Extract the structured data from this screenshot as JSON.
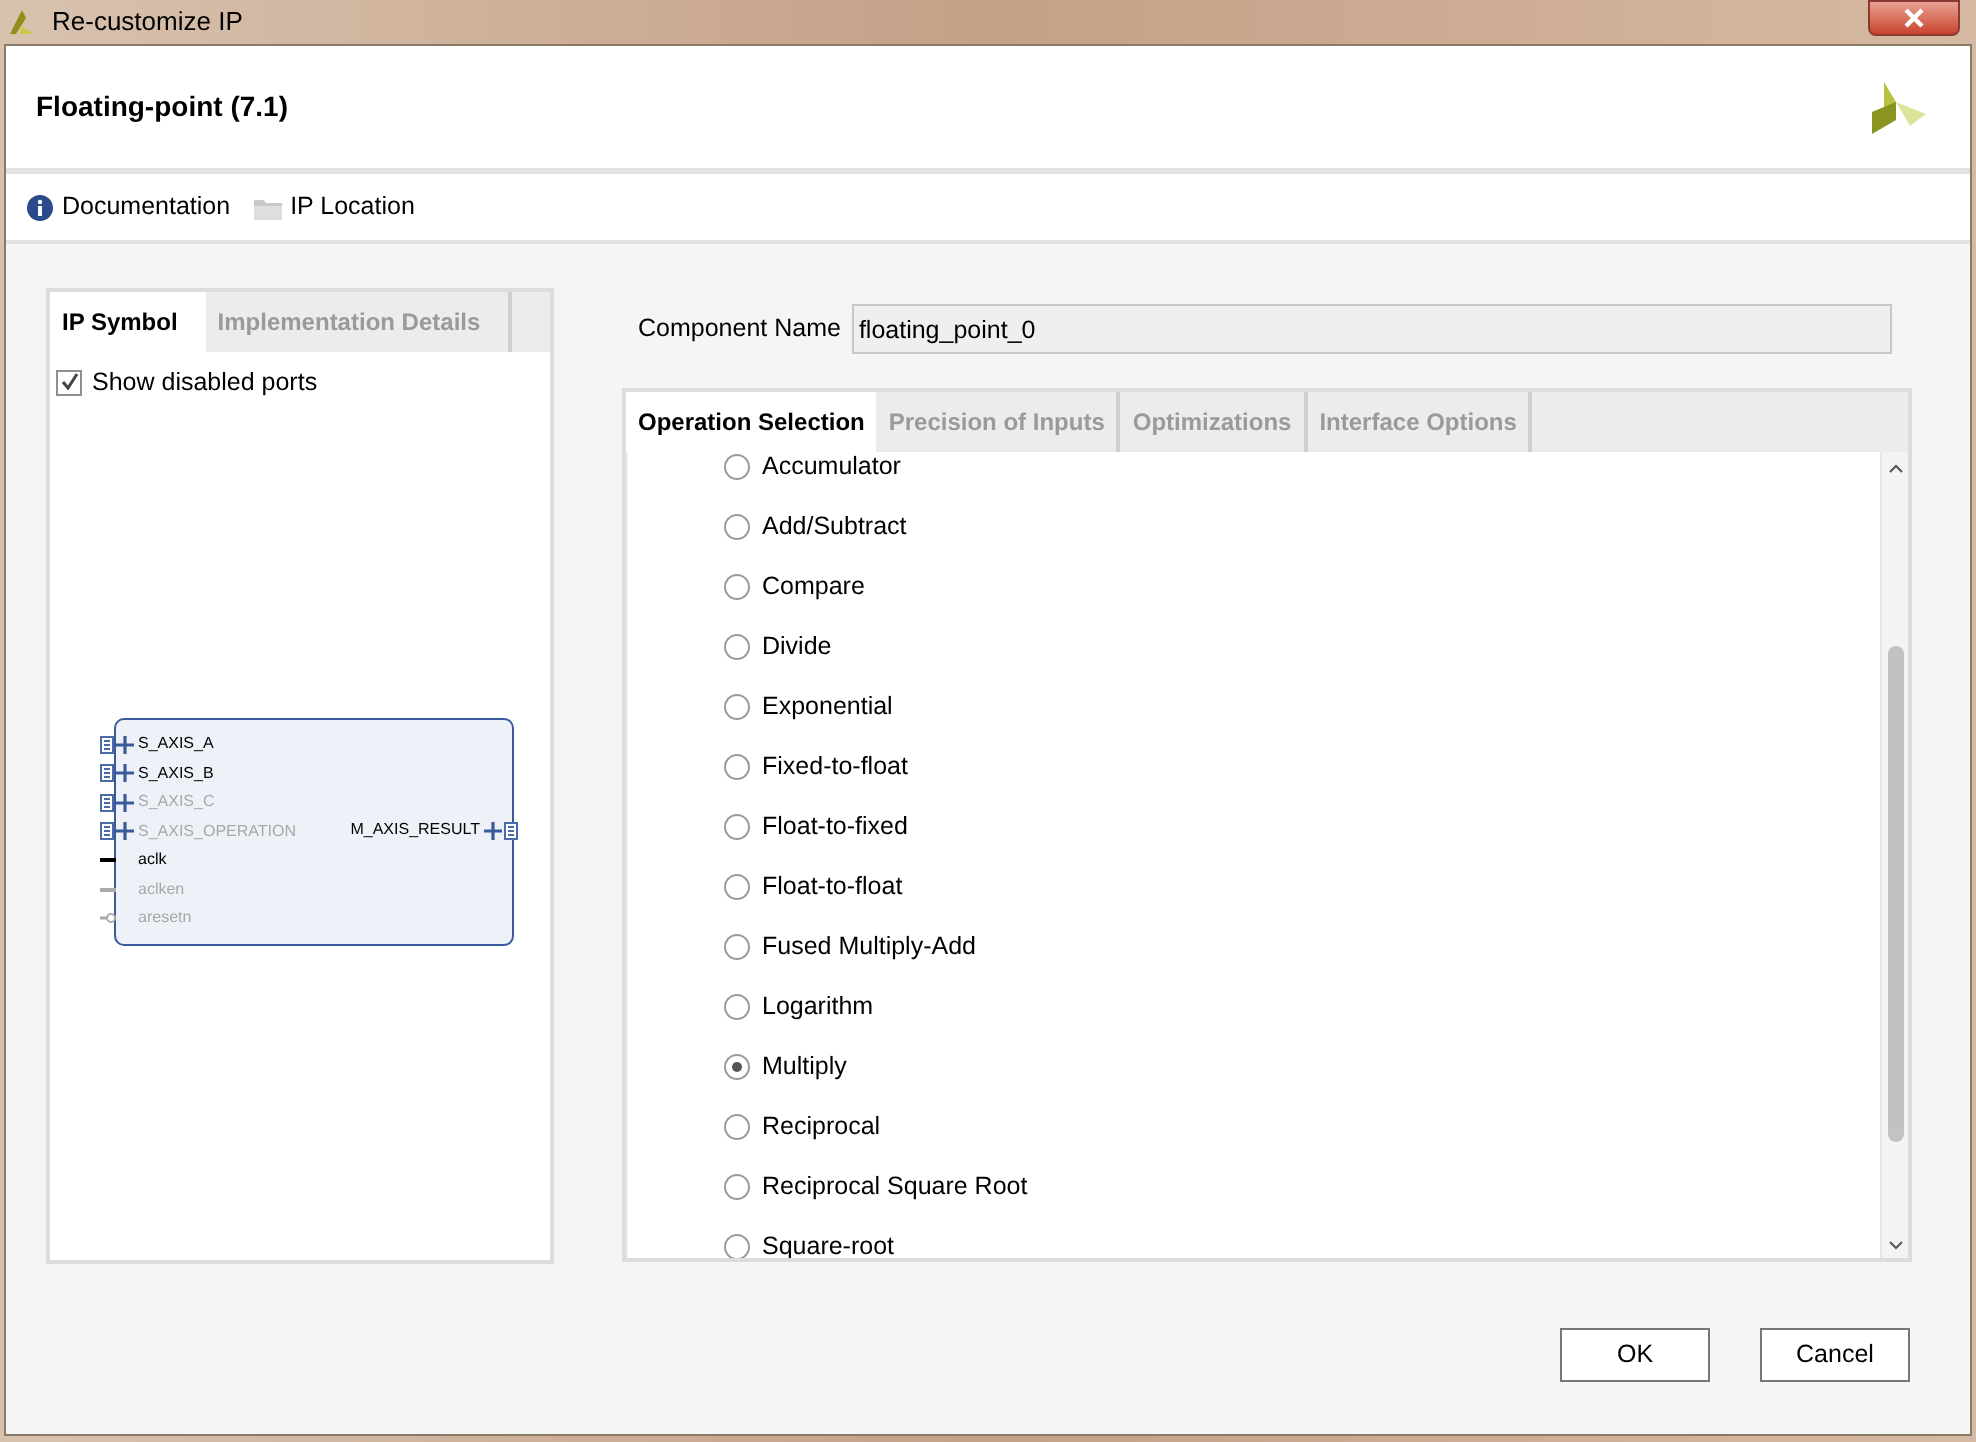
{
  "window": {
    "title": "Re-customize IP"
  },
  "header": {
    "title": "Floating-point (7.1)"
  },
  "links": [
    {
      "kind": "info",
      "label": "Documentation"
    },
    {
      "kind": "folder",
      "label": "IP Location"
    }
  ],
  "left_panel": {
    "tabs": [
      {
        "label": "IP Symbol",
        "selected": true
      },
      {
        "label": "Implementation Details",
        "selected": false
      }
    ],
    "show_disabled_ports": {
      "label": "Show disabled ports",
      "checked": true
    },
    "symbol": {
      "left_ports": [
        {
          "name": "S_AXIS_A",
          "kind": "bus",
          "disabled": false
        },
        {
          "name": "S_AXIS_B",
          "kind": "bus",
          "disabled": false
        },
        {
          "name": "S_AXIS_C",
          "kind": "bus",
          "disabled": true
        },
        {
          "name": "S_AXIS_OPERATION",
          "kind": "bus",
          "disabled": true
        },
        {
          "name": "aclk",
          "kind": "clock",
          "disabled": false
        },
        {
          "name": "aclken",
          "kind": "clock",
          "disabled": true
        },
        {
          "name": "aresetn",
          "kind": "reset",
          "disabled": true
        }
      ],
      "right_ports": [
        {
          "name": "M_AXIS_RESULT",
          "kind": "bus",
          "disabled": false
        }
      ]
    }
  },
  "component_name": {
    "label": "Component Name",
    "value": "floating_point_0"
  },
  "right_panel": {
    "tabs": [
      {
        "label": "Operation Selection",
        "selected": true
      },
      {
        "label": "Precision of Inputs",
        "selected": false
      },
      {
        "label": "Optimizations",
        "selected": false
      },
      {
        "label": "Interface Options",
        "selected": false
      }
    ],
    "operations": [
      {
        "label": "Accumulator",
        "selected": false
      },
      {
        "label": "Add/Subtract",
        "selected": false
      },
      {
        "label": "Compare",
        "selected": false
      },
      {
        "label": "Divide",
        "selected": false
      },
      {
        "label": "Exponential",
        "selected": false
      },
      {
        "label": "Fixed-to-float",
        "selected": false
      },
      {
        "label": "Float-to-fixed",
        "selected": false
      },
      {
        "label": "Float-to-float",
        "selected": false
      },
      {
        "label": "Fused Multiply-Add",
        "selected": false
      },
      {
        "label": "Logarithm",
        "selected": false
      },
      {
        "label": "Multiply",
        "selected": true
      },
      {
        "label": "Reciprocal",
        "selected": false
      },
      {
        "label": "Reciprocal Square Root",
        "selected": false
      },
      {
        "label": "Square-root",
        "selected": false
      }
    ]
  },
  "buttons": [
    {
      "label": "OK"
    },
    {
      "label": "Cancel"
    }
  ]
}
